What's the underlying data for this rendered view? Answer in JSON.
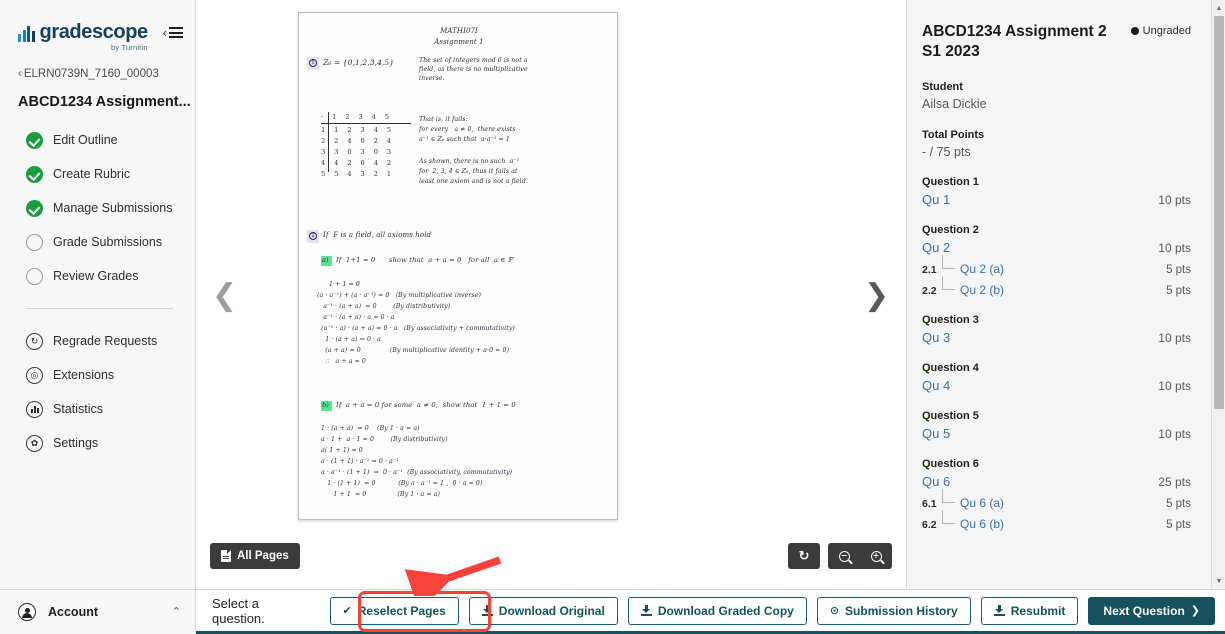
{
  "sidebar": {
    "logo": {
      "word": "gradescope",
      "sub": "by Turnitin",
      "mark": "bar-chart-logo"
    },
    "collapse_label": "collapse-sidebar",
    "breadcrumb": "ELRN0739N_7160_00003",
    "breadcrumb_chevron": "‹",
    "assignment_title": "ABCD1234 Assignment...",
    "nav_primary": [
      {
        "label": "Edit Outline",
        "state": "done"
      },
      {
        "label": "Create Rubric",
        "state": "done"
      },
      {
        "label": "Manage Submissions",
        "state": "done"
      },
      {
        "label": "Grade Submissions",
        "state": "todo"
      },
      {
        "label": "Review Grades",
        "state": "todo"
      }
    ],
    "nav_secondary": [
      {
        "label": "Regrade Requests",
        "icon": "regrade-icon",
        "glyph": "↻"
      },
      {
        "label": "Extensions",
        "icon": "clock-icon",
        "glyph": "◎"
      },
      {
        "label": "Statistics",
        "icon": "statistics-icon",
        "glyph": "bars"
      },
      {
        "label": "Settings",
        "icon": "gear-icon",
        "glyph": "✿"
      }
    ],
    "account": {
      "label": "Account",
      "caret": "⌃"
    }
  },
  "viewer": {
    "prev_arrow": "❮",
    "next_arrow": "❯",
    "all_pages_label": "All Pages",
    "rotate_glyph": "↻",
    "zoom_out_glyph": "−",
    "zoom_in_glyph": "+",
    "document": {
      "title_line1": "MATHI07I",
      "title_line2": "Assignment 1",
      "q1_set": "Z₆ = {0,1,2,3,4,5}",
      "q1_text1": "The set of integers mod 6 is not a",
      "q1_text2": "field, as there is no multiplicative",
      "q1_text3": "inverse.",
      "table_header": "·  1  2  3  4  5",
      "table_rows": [
        "1  1  2  3  4  5",
        "2  2  4  0  2  4",
        "3  3  0  3  0  3",
        "4  4  2  0  4  2",
        "5  5  4  3  2  1"
      ],
      "q1_text4": "That is, it fails:",
      "q1_text5": "for every   a ≠ 0,  there exists",
      "q1_text6": "a⁻¹ ∈ Z₆ such that  a·a⁻¹ = 1",
      "q1_text7": "As shown, there is no such  a⁻¹",
      "q1_text8": "for  2, 3, 4 ∈ Z₆, thus it fails at",
      "q1_text9": "least one axiom and is not a field.",
      "q2_stem": "If  F is a field, all axioms hold",
      "q2a_stem": "If  1+1 = 0      show that  a + a = 0   for all  a ∈ 𝔽",
      "q2a_lines": [
        "1 + 1 = 0",
        "(a · a⁻¹) + (a · a⁻¹) = 0   (By multiplicative inverse)",
        "   a⁻¹ · (a + a)  = 0        (By distributivity)",
        "   a⁻¹ · (a + a) · a = 0 · a",
        "  (a⁻¹ · a) · (a + a) = 0 · a   (By associativity + commutativity)",
        "    1 · (a + a) = 0 · a",
        "    (a + a) = 0              (By multiplicative identity + a·0 = 0)",
        "    ∴   a + a = 0"
      ],
      "q2b_stem": "If  a + a = 0 for some  a ≠ 0,  show that  1 + 1 = 0",
      "q2b_lines": [
        "1 · (a + a)  = 0    (By 1 · a = a)",
        "a · 1 +  a · 1 = 0        (By distributivity)",
        "a( 1 + 1) = 0",
        "a · (1 + 1) · a⁻¹ = 0 · a⁻¹",
        "a · a⁻¹ · (1 + 1)  =  0 · a⁻¹  (By associativity, commutativity)",
        "   1 · (1 + 1)  = 0           (By a · a⁻¹ = 1 ,  0 · a = 0)",
        "      1 + 1  = 0               (By 1 · a = a)"
      ],
      "marker_a": "a)",
      "marker_b": "b)",
      "circle_1": "1",
      "circle_2": "2"
    }
  },
  "right_panel": {
    "title": "ABCD1234 Assignment 2 S1 2023",
    "status": "Ungraded",
    "student_label": "Student",
    "student_name": "Ailsa Dickie",
    "total_points_label": "Total Points",
    "total_points_value": "- / 75 pts",
    "questions": [
      {
        "head": "Question 1",
        "rows": [
          {
            "idx": "",
            "label": "Qu 1",
            "pts": "10 pts",
            "sub": false
          }
        ]
      },
      {
        "head": "Question 2",
        "rows": [
          {
            "idx": "",
            "label": "Qu 2",
            "pts": "10 pts",
            "sub": false
          },
          {
            "idx": "2.1",
            "label": "Qu 2 (a)",
            "pts": "5 pts",
            "sub": true
          },
          {
            "idx": "2.2",
            "label": "Qu 2 (b)",
            "pts": "5 pts",
            "sub": true
          }
        ]
      },
      {
        "head": "Question 3",
        "rows": [
          {
            "idx": "",
            "label": "Qu 3",
            "pts": "10 pts",
            "sub": false
          }
        ]
      },
      {
        "head": "Question 4",
        "rows": [
          {
            "idx": "",
            "label": "Qu 4",
            "pts": "10 pts",
            "sub": false
          }
        ]
      },
      {
        "head": "Question 5",
        "rows": [
          {
            "idx": "",
            "label": "Qu 5",
            "pts": "10 pts",
            "sub": false
          }
        ]
      },
      {
        "head": "Question 6",
        "rows": [
          {
            "idx": "",
            "label": "Qu 6",
            "pts": "25 pts",
            "sub": false
          },
          {
            "idx": "6.1",
            "label": "Qu 6 (a)",
            "pts": "5 pts",
            "sub": true
          },
          {
            "idx": "6.2",
            "label": "Qu 6 (b)",
            "pts": "5 pts",
            "sub": true
          }
        ]
      }
    ],
    "scroll_up_glyph": "▲",
    "scroll_down_glyph": "▼"
  },
  "toolbar": {
    "select_prompt": "Select a question.",
    "reselect_pages": "Reselect Pages",
    "reselect_check": "✔",
    "download_original": "Download Original",
    "download_graded_copy": "Download Graded Copy",
    "submission_history": "Submission History",
    "submission_history_glyph": "⊙",
    "resubmit": "Resubmit",
    "next_question": "Next Question",
    "next_question_chevron": "❯"
  },
  "annotation": {
    "highlight_color": "#f5433c",
    "target": "reselect-pages-button"
  }
}
